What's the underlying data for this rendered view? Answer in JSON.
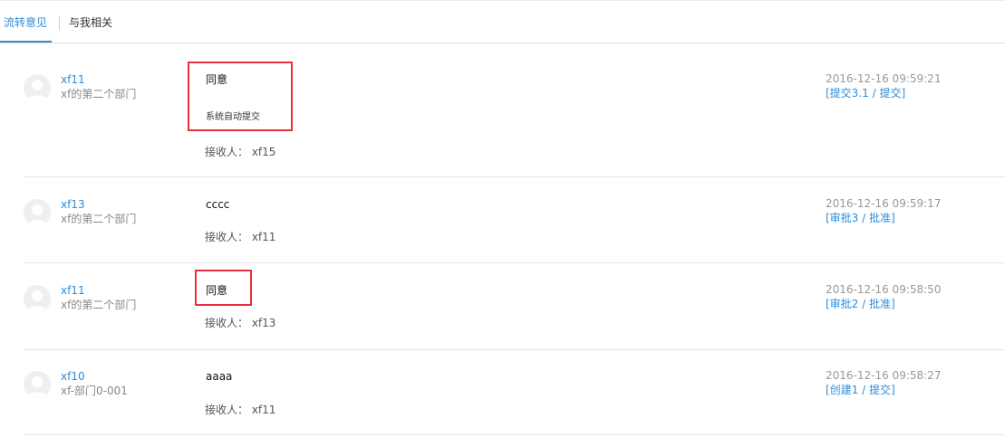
{
  "tabs": [
    {
      "label": "流转意见",
      "active": true
    },
    {
      "label": "与我相关",
      "active": false
    }
  ],
  "records": [
    {
      "user": "xf11",
      "dept": "xf的第二个部门",
      "comment": "同意",
      "auto_note": "系统自动提交",
      "recipient": "接收人： xf15",
      "timestamp": "2016-12-16   09:59:21",
      "action": "[提交3.1 / 提交]"
    },
    {
      "user": "xf13",
      "dept": "xf的第二个部门",
      "comment": "cccc",
      "recipient": "接收人： xf11",
      "timestamp": "2016-12-16   09:59:17",
      "action": "[审批3 / 批准]"
    },
    {
      "user": "xf11",
      "dept": "xf的第二个部门",
      "comment": "同意",
      "recipient": "接收人： xf13",
      "timestamp": "2016-12-16   09:58:50",
      "action": "[审批2 / 批准]"
    },
    {
      "user": "xf10",
      "dept": "xf-部门0-001",
      "comment": "aaaa",
      "recipient": "接收人： xf11",
      "timestamp": "2016-12-16   09:58:27",
      "action": "[创建1 / 提交]"
    }
  ],
  "icons": {
    "avatar": "user-silhouette-icon"
  },
  "colors": {
    "accent": "#2d8cd9",
    "highlight": "#e5323a",
    "text_muted": "#999999"
  }
}
